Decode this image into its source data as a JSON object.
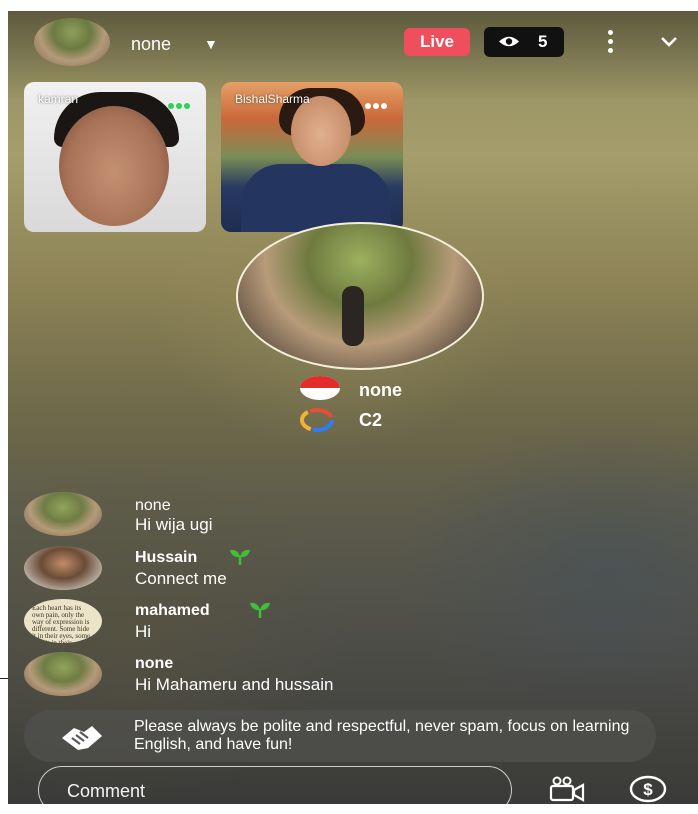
{
  "header": {
    "host_name": "none",
    "live_label": "Live",
    "viewer_count": "5"
  },
  "guests": [
    {
      "name": "kamran"
    },
    {
      "name": "BishalSharma"
    }
  ],
  "host": {
    "name": "none",
    "level": "C2"
  },
  "chat": [
    {
      "name": "none",
      "text": "Hi wija ugi",
      "sprout": false
    },
    {
      "name": "Hussain",
      "text": "Connect me",
      "sprout": true
    },
    {
      "name": "mahamed",
      "text": "Hi",
      "sprout": true
    },
    {
      "name": "none",
      "text": "Hi Mahameru and hussain",
      "sprout": false
    }
  ],
  "avatar_c_caption": "Each heart has its own pain, only the way of expression is different. Some hide it in their eyes, some hide it in their smiles.",
  "notice": "Please always be polite and respectful, never spam, focus on learning English, and have fun!",
  "comment": {
    "placeholder": "Comment"
  },
  "colors": {
    "live": "#ef4f5d",
    "sprout": "#3fbf3a",
    "online_dot": "#2fd05a"
  },
  "icons": [
    "caret-down-icon",
    "eye-icon",
    "more-vertical-icon",
    "chevron-down-icon",
    "online-dots-icon",
    "indonesia-flag-icon",
    "loading-ring-icon",
    "sprout-icon",
    "handshake-icon",
    "video-camera-icon",
    "dollar-coin-icon"
  ]
}
